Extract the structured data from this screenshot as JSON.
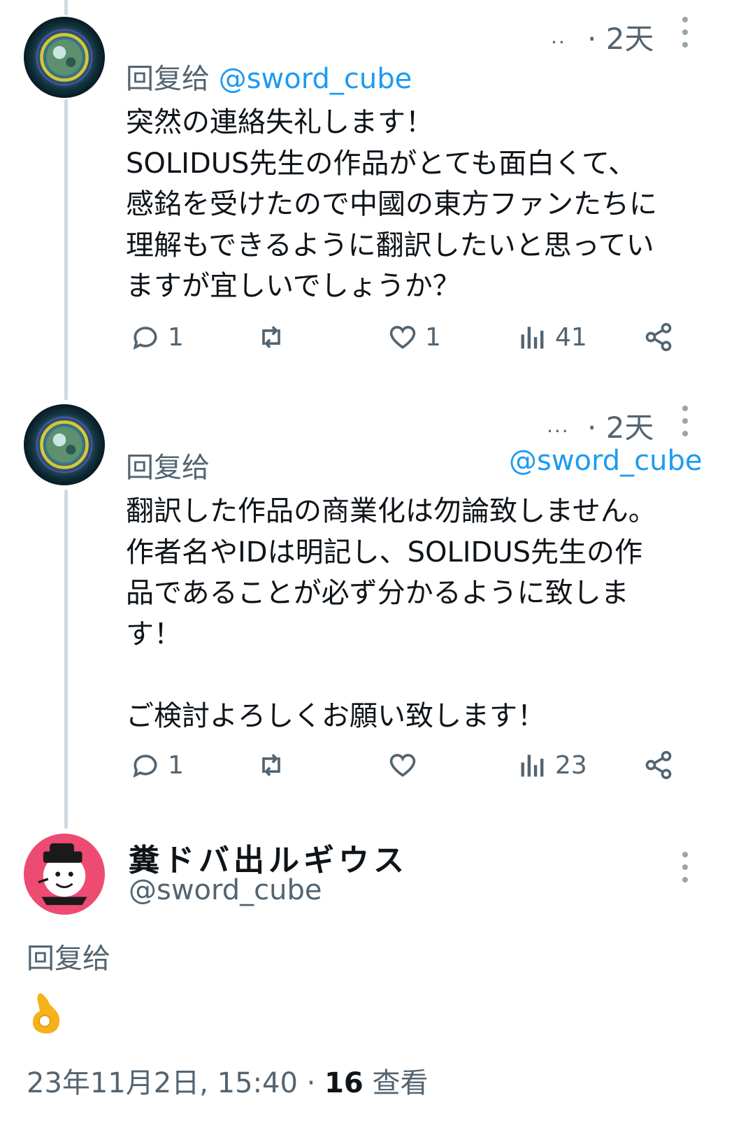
{
  "colors": {
    "accent": "#1d9bf0",
    "muted": "#536471",
    "text": "#0f1419",
    "thread": "#cfd9de"
  },
  "tweets": [
    {
      "dots": "..",
      "time": "· 2天",
      "reply_prefix": "回复给",
      "reply_to": "@sword_cube",
      "text": "突然の連絡失礼します！\nSOLIDUS先生の作品がとても面白くて、\n感銘を受けたので中國の東方ファンたちに\n理解もできるように翻訳したいと思ってい\nますが宜しいでしょうか？",
      "replies": "1",
      "likes": "1",
      "views": "41"
    },
    {
      "dots": "...",
      "time": "· 2天",
      "reply_prefix": "回复给",
      "reply_to": "@sword_cube",
      "text": "翻訳した作品の商業化は勿論致しません。\n作者名やIDは明記し、SOLIDUS先生の作\n品であることが必ず分かるように致しま\nす！\n\nご検討よろしくお願い致します！",
      "replies": "1",
      "likes": "",
      "views": "23"
    }
  ],
  "main_tweet": {
    "name": "糞ドバ出ルギウス",
    "handle": "@sword_cube",
    "reply_prefix": "回复给",
    "emoji_icon": "ok-hand-emoji",
    "date": "23年11月2日, 15:40 · ",
    "views_count": "16",
    "views_label": " 查看"
  }
}
